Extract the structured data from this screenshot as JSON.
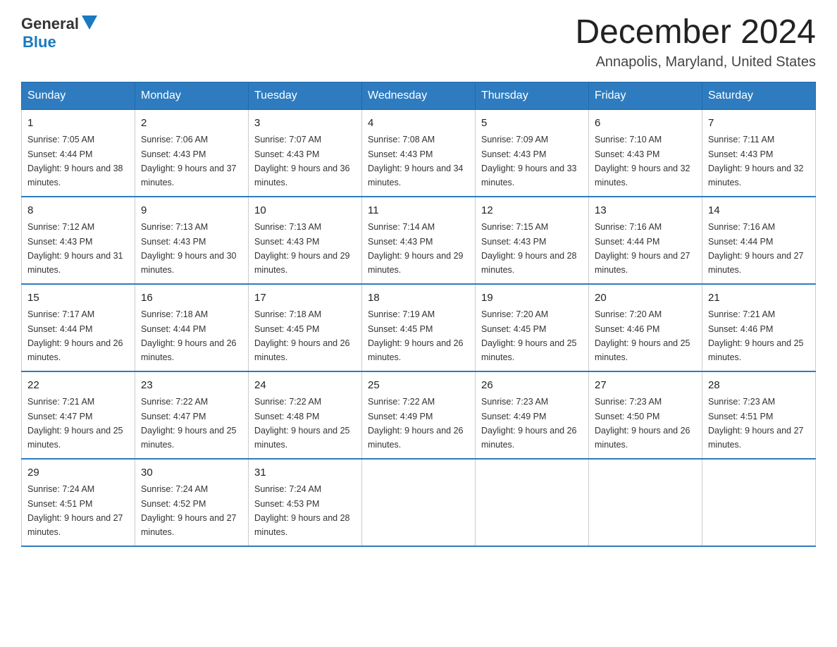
{
  "logo": {
    "text_general": "General",
    "text_blue": "Blue"
  },
  "header": {
    "month_title": "December 2024",
    "location": "Annapolis, Maryland, United States"
  },
  "days_of_week": [
    "Sunday",
    "Monday",
    "Tuesday",
    "Wednesday",
    "Thursday",
    "Friday",
    "Saturday"
  ],
  "weeks": [
    [
      {
        "day": "1",
        "sunrise": "7:05 AM",
        "sunset": "4:44 PM",
        "daylight": "9 hours and 38 minutes."
      },
      {
        "day": "2",
        "sunrise": "7:06 AM",
        "sunset": "4:43 PM",
        "daylight": "9 hours and 37 minutes."
      },
      {
        "day": "3",
        "sunrise": "7:07 AM",
        "sunset": "4:43 PM",
        "daylight": "9 hours and 36 minutes."
      },
      {
        "day": "4",
        "sunrise": "7:08 AM",
        "sunset": "4:43 PM",
        "daylight": "9 hours and 34 minutes."
      },
      {
        "day": "5",
        "sunrise": "7:09 AM",
        "sunset": "4:43 PM",
        "daylight": "9 hours and 33 minutes."
      },
      {
        "day": "6",
        "sunrise": "7:10 AM",
        "sunset": "4:43 PM",
        "daylight": "9 hours and 32 minutes."
      },
      {
        "day": "7",
        "sunrise": "7:11 AM",
        "sunset": "4:43 PM",
        "daylight": "9 hours and 32 minutes."
      }
    ],
    [
      {
        "day": "8",
        "sunrise": "7:12 AM",
        "sunset": "4:43 PM",
        "daylight": "9 hours and 31 minutes."
      },
      {
        "day": "9",
        "sunrise": "7:13 AM",
        "sunset": "4:43 PM",
        "daylight": "9 hours and 30 minutes."
      },
      {
        "day": "10",
        "sunrise": "7:13 AM",
        "sunset": "4:43 PM",
        "daylight": "9 hours and 29 minutes."
      },
      {
        "day": "11",
        "sunrise": "7:14 AM",
        "sunset": "4:43 PM",
        "daylight": "9 hours and 29 minutes."
      },
      {
        "day": "12",
        "sunrise": "7:15 AM",
        "sunset": "4:43 PM",
        "daylight": "9 hours and 28 minutes."
      },
      {
        "day": "13",
        "sunrise": "7:16 AM",
        "sunset": "4:44 PM",
        "daylight": "9 hours and 27 minutes."
      },
      {
        "day": "14",
        "sunrise": "7:16 AM",
        "sunset": "4:44 PM",
        "daylight": "9 hours and 27 minutes."
      }
    ],
    [
      {
        "day": "15",
        "sunrise": "7:17 AM",
        "sunset": "4:44 PM",
        "daylight": "9 hours and 26 minutes."
      },
      {
        "day": "16",
        "sunrise": "7:18 AM",
        "sunset": "4:44 PM",
        "daylight": "9 hours and 26 minutes."
      },
      {
        "day": "17",
        "sunrise": "7:18 AM",
        "sunset": "4:45 PM",
        "daylight": "9 hours and 26 minutes."
      },
      {
        "day": "18",
        "sunrise": "7:19 AM",
        "sunset": "4:45 PM",
        "daylight": "9 hours and 26 minutes."
      },
      {
        "day": "19",
        "sunrise": "7:20 AM",
        "sunset": "4:45 PM",
        "daylight": "9 hours and 25 minutes."
      },
      {
        "day": "20",
        "sunrise": "7:20 AM",
        "sunset": "4:46 PM",
        "daylight": "9 hours and 25 minutes."
      },
      {
        "day": "21",
        "sunrise": "7:21 AM",
        "sunset": "4:46 PM",
        "daylight": "9 hours and 25 minutes."
      }
    ],
    [
      {
        "day": "22",
        "sunrise": "7:21 AM",
        "sunset": "4:47 PM",
        "daylight": "9 hours and 25 minutes."
      },
      {
        "day": "23",
        "sunrise": "7:22 AM",
        "sunset": "4:47 PM",
        "daylight": "9 hours and 25 minutes."
      },
      {
        "day": "24",
        "sunrise": "7:22 AM",
        "sunset": "4:48 PM",
        "daylight": "9 hours and 25 minutes."
      },
      {
        "day": "25",
        "sunrise": "7:22 AM",
        "sunset": "4:49 PM",
        "daylight": "9 hours and 26 minutes."
      },
      {
        "day": "26",
        "sunrise": "7:23 AM",
        "sunset": "4:49 PM",
        "daylight": "9 hours and 26 minutes."
      },
      {
        "day": "27",
        "sunrise": "7:23 AM",
        "sunset": "4:50 PM",
        "daylight": "9 hours and 26 minutes."
      },
      {
        "day": "28",
        "sunrise": "7:23 AM",
        "sunset": "4:51 PM",
        "daylight": "9 hours and 27 minutes."
      }
    ],
    [
      {
        "day": "29",
        "sunrise": "7:24 AM",
        "sunset": "4:51 PM",
        "daylight": "9 hours and 27 minutes."
      },
      {
        "day": "30",
        "sunrise": "7:24 AM",
        "sunset": "4:52 PM",
        "daylight": "9 hours and 27 minutes."
      },
      {
        "day": "31",
        "sunrise": "7:24 AM",
        "sunset": "4:53 PM",
        "daylight": "9 hours and 28 minutes."
      },
      null,
      null,
      null,
      null
    ]
  ]
}
